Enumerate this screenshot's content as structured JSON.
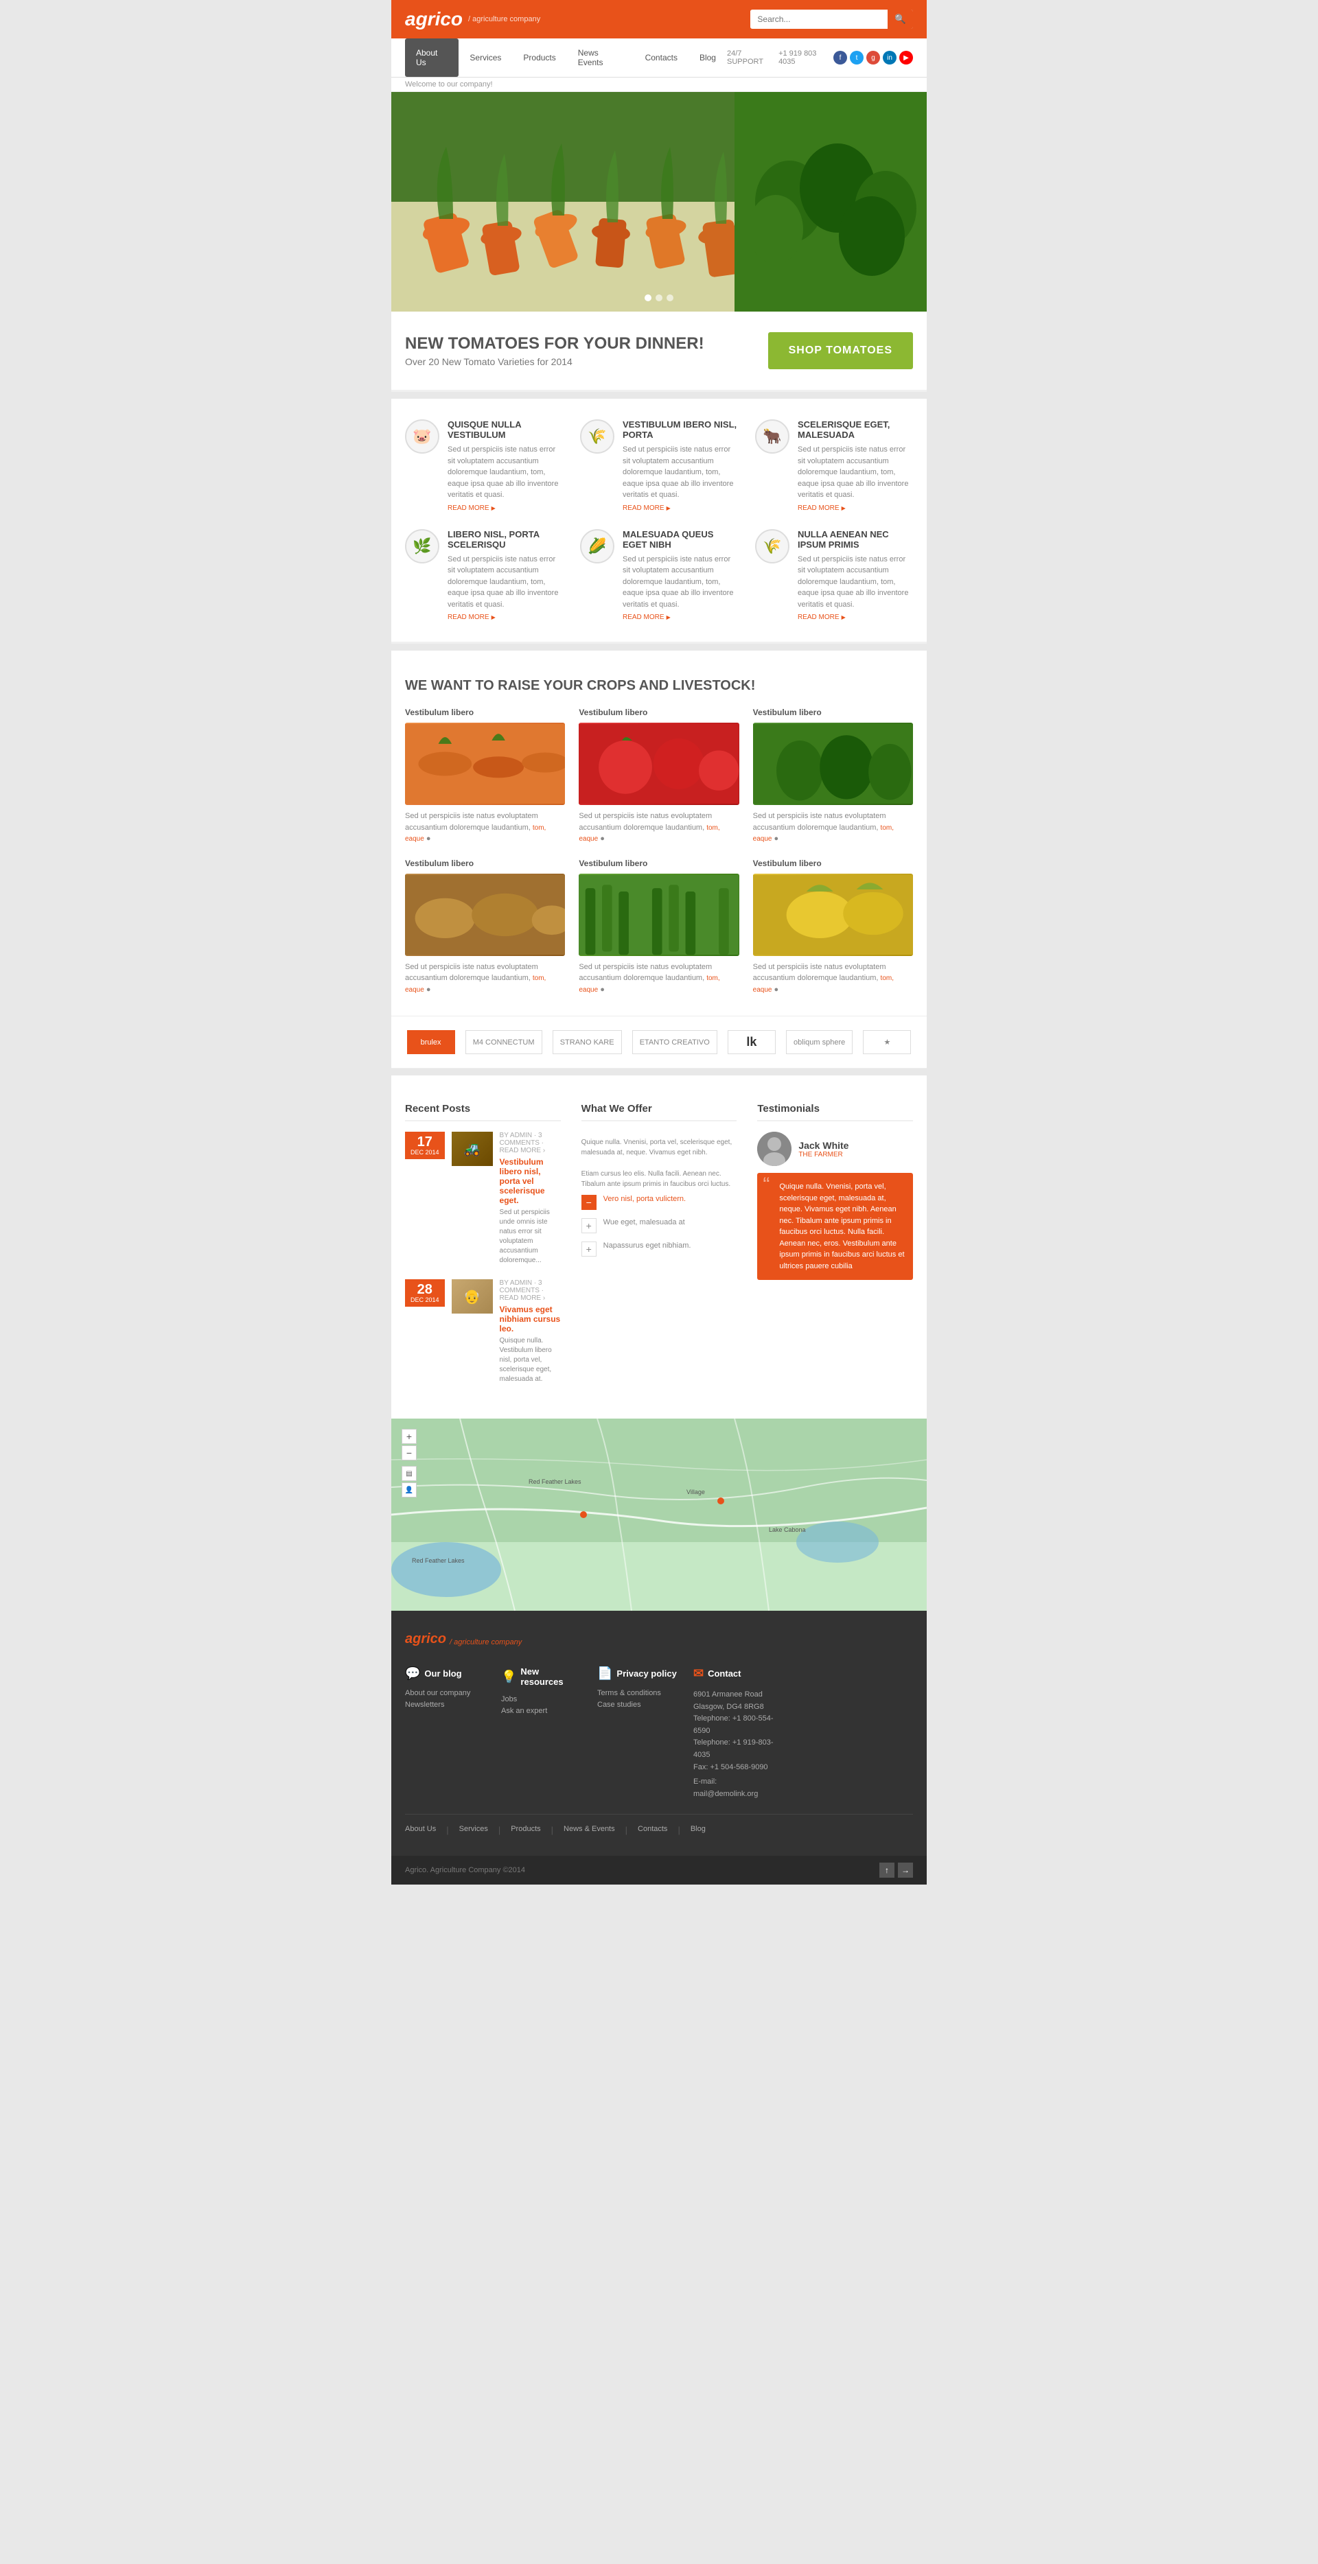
{
  "header": {
    "logo": "agrico",
    "logo_sub": "/ agriculture company",
    "search_placeholder": "Search...",
    "search_label": "🔍"
  },
  "nav": {
    "items": [
      {
        "label": "About Us",
        "active": true
      },
      {
        "label": "Services",
        "active": false
      },
      {
        "label": "Products",
        "active": false
      },
      {
        "label": "News Events",
        "active": false
      },
      {
        "label": "Contacts",
        "active": false
      },
      {
        "label": "Blog",
        "active": false
      }
    ],
    "support_label": "24/7 SUPPORT",
    "phone": "+1 919 803 4035"
  },
  "welcome": "Welcome to our company!",
  "promo": {
    "headline": "NEW TOMATOES FOR YOUR DINNER!",
    "subline": "Over 20 New Tomato Varieties for 2014",
    "button": "SHOP TOMATOES"
  },
  "features": [
    {
      "icon": "🐷",
      "title": "QUISQUE NULLA VESTIBULUM",
      "desc": "Sed ut perspiciis iste natus error sit voluptatem accusantium doloremque laudantium, tom, eaque ipsa quae ab illo inventore veritatis et quasi.",
      "read_more": "READ MORE"
    },
    {
      "icon": "🌾",
      "title": "VESTIBULUM IBERO NISL, PORTA",
      "desc": "Sed ut perspiciis iste natus error sit voluptatem accusantium doloremque laudantium, tom, eaque ipsa quae ab illo inventore veritatis et quasi.",
      "read_more": "READ MORE"
    },
    {
      "icon": "🐂",
      "title": "SCELERISQUE EGET, MALESUADA",
      "desc": "Sed ut perspiciis iste natus error sit voluptatem accusantium doloremque laudantium, tom, eaque ipsa quae ab illo inventore veritatis et quasi.",
      "read_more": "READ MORE"
    },
    {
      "icon": "🌿",
      "title": "LIBERO NISL, PORTA SCELERISQU",
      "desc": "Sed ut perspiciis iste natus error sit voluptatem accusantium doloremque laudantium, tom, eaque ipsa quae ab illo inventore veritatis et quasi.",
      "read_more": "READ MORE"
    },
    {
      "icon": "🌽",
      "title": "MALESUADA QUEUS EGET NIBH",
      "desc": "Sed ut perspiciis iste natus error sit voluptatem accusantium doloremque laudantium, tom, eaque ipsa quae ab illo inventore veritatis et quasi.",
      "read_more": "READ MORE"
    },
    {
      "icon": "🌾",
      "title": "NULLA AENEAN NEC IPSUM PRIMIS",
      "desc": "Sed ut perspiciis iste natus error sit voluptatem accusantium doloremque laudantium, tom, eaque ipsa quae ab illo inventore veritatis et quasi.",
      "read_more": "READ MORE"
    }
  ],
  "crops": {
    "heading": "WE WANT TO RAISE YOUR CROPS AND LIVESTOCK!",
    "items": [
      {
        "title": "Vestibulum libero",
        "desc": "Sed ut perspiciis iste natus evoluptatem accusantium doloremque laudantium, tom, eaque",
        "link": "tom, eaque",
        "color": "carrot"
      },
      {
        "title": "Vestibulum libero",
        "desc": "Sed ut perspiciis iste natus evoluptatem accusantium doloremque laudantium, tom, eaque",
        "link": "tom, eaque",
        "color": "tomato"
      },
      {
        "title": "Vestibulum libero",
        "desc": "Sed ut perspiciis iste natus evoluptatem accusantium doloremque laudantium, tom, eaque",
        "link": "tom, eaque",
        "color": "artichoke"
      },
      {
        "title": "Vestibulum libero",
        "desc": "Sed ut perspiciis iste natus evoluptatem accusantium doloremque laudantium, tom, eaque",
        "link": "tom, eaque",
        "color": "potato"
      },
      {
        "title": "Vestibulum libero",
        "desc": "Sed ut perspiciis iste natus evoluptatem accusantium doloremque laudantium, tom, eaque",
        "link": "tom, eaque",
        "color": "greens"
      },
      {
        "title": "Vestibulum libero",
        "desc": "Sed ut perspiciis iste natus evoluptatem accusantium doloremque laudantium, tom, eaque",
        "link": "tom, eaque",
        "color": "corn"
      }
    ]
  },
  "partners": [
    "brulex",
    "M4 CONNECTUM",
    "STRANO KARE",
    "ETANTO CREATIVO",
    "lk",
    "obliqum sphere",
    "★"
  ],
  "recent_posts": {
    "heading": "Recent Posts",
    "posts": [
      {
        "day": "17",
        "month": "DEC 2014",
        "meta": "BY ADMIN · 3 COMMENTS · READ MORE ›",
        "title": "Vestibulum libero nisl, porta vel scelerisque eget.",
        "excerpt": "Sed ut perspiciis unde omnis iste natus error sit voluptatem accusantium doloremque...",
        "emoji": "🚜"
      },
      {
        "day": "28",
        "month": "DEC 2014",
        "meta": "BY ADMIN · 3 COMMENTS · READ MORE ›",
        "title": "Vivamus eget nibhiam cursus leo.",
        "excerpt": "Quisque nulla. Vestibulum libero nisl, porta vel, scelerisque eget, malesuada at.",
        "emoji": "👴"
      }
    ]
  },
  "what_we_offer": {
    "heading": "What We Offer",
    "intro": "Quique nulla. Vnenisi, porta vel, scelerisque eget, malesuada at, neque. Vivamus eget nibh.",
    "desc": "Etiam cursus leo elis. Nulla facili. Aenean nec. Tibalum ante ipsum primis in faucibus orci luctus.",
    "items": [
      {
        "icon": "−",
        "label": "Vero nisl, porta vulictern.",
        "active": true
      },
      {
        "icon": "+",
        "label": "Wue eget, malesuada at",
        "active": false
      },
      {
        "icon": "+",
        "label": "Napassurus eget nibhiam.",
        "active": false
      }
    ]
  },
  "testimonials": {
    "heading": "Testimonials",
    "name": "Jack White",
    "role": "THE FARMER",
    "text": "Quique nulla. Vnenisi, porta vel, scelerisque eget, malesuada at, neque. Vivamus eget nibh. Aenean nec. Tibalum ante ipsum primis in faucibus orci luctus. Nulla facili. Aenean nec, eros. Vestibulum ante ipsum primis in faucibus arci luctus et ultrices pauere cubilia"
  },
  "footer": {
    "logo": "agrico",
    "logo_sub": "/ agriculture company",
    "cols": [
      {
        "icon": "💬",
        "title": "Our blog",
        "links": [
          "About our company",
          "Newsletters"
        ]
      },
      {
        "icon": "💡",
        "title": "New resources",
        "links": [
          "Jobs",
          "Ask an expert"
        ]
      },
      {
        "icon": "📄",
        "title": "Privacy policy",
        "links": [
          "Terms & conditions",
          "Case studies"
        ]
      },
      {
        "icon": "✉",
        "title": "Contact",
        "address": "6901 Armanee Road\nGlasgow, DG4 8RG8\nTelephone: +1 800-554-6590\nTelephone: +1 919-803-4035\nFax: +1 504-568-9090",
        "email": "E-mail: mail@demolink.org"
      }
    ],
    "bottom_nav": [
      "About Us",
      "Services",
      "Products",
      "News & Events",
      "Contacts",
      "Blog"
    ],
    "copyright": "Agrico. Agriculture Company ©2014"
  },
  "footer_bottom_nav": {
    "items": [
      "About Us",
      "Services",
      "Products",
      "News & Events",
      "Contacts",
      "Blog"
    ],
    "copyright": "Agrico. Agriculture Company ©2014"
  }
}
